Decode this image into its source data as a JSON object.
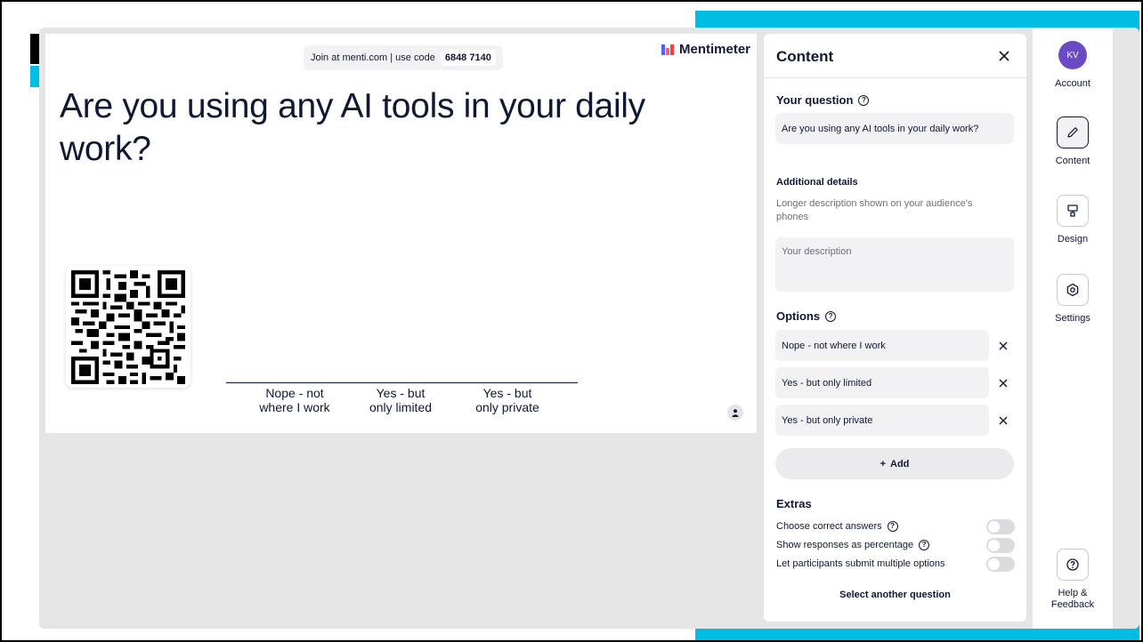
{
  "slide": {
    "join_text": "Join at menti.com | use code",
    "join_code": "6848 7140",
    "brand": "Mentimeter",
    "title": "Are you using any AI tools in your daily work?",
    "axis_labels": [
      {
        "line1": "Nope - not",
        "line2": "where I work"
      },
      {
        "line1": "Yes - but",
        "line2": "only limited"
      },
      {
        "line1": "Yes - but",
        "line2": "only private"
      }
    ]
  },
  "panel": {
    "title": "Content",
    "question_label": "Your question",
    "question_value": "Are you using any AI tools in your daily work?",
    "details_label": "Additional details",
    "details_hint": "Longer description shown on your audience's phones",
    "description_placeholder": "Your description",
    "options_label": "Options",
    "options": [
      "Nope - not where I work",
      "Yes - but only limited",
      "Yes - but only private"
    ],
    "add_label": "Add",
    "extras_label": "Extras",
    "extras": [
      {
        "label": "Choose correct answers",
        "has_help": true,
        "enabled": false
      },
      {
        "label": "Show responses as percentage",
        "has_help": true,
        "enabled": false
      },
      {
        "label": "Let participants submit multiple options",
        "has_help": false,
        "enabled": false
      }
    ],
    "select_another": "Select another question"
  },
  "rail": {
    "avatar_initials": "KV",
    "account": "Account",
    "content": "Content",
    "design": "Design",
    "settings": "Settings",
    "help_line1": "Help &",
    "help_line2": "Feedback"
  },
  "colors": {
    "accent_cyan": "#00bde4",
    "avatar": "#6a4bc4",
    "text": "#101834"
  }
}
